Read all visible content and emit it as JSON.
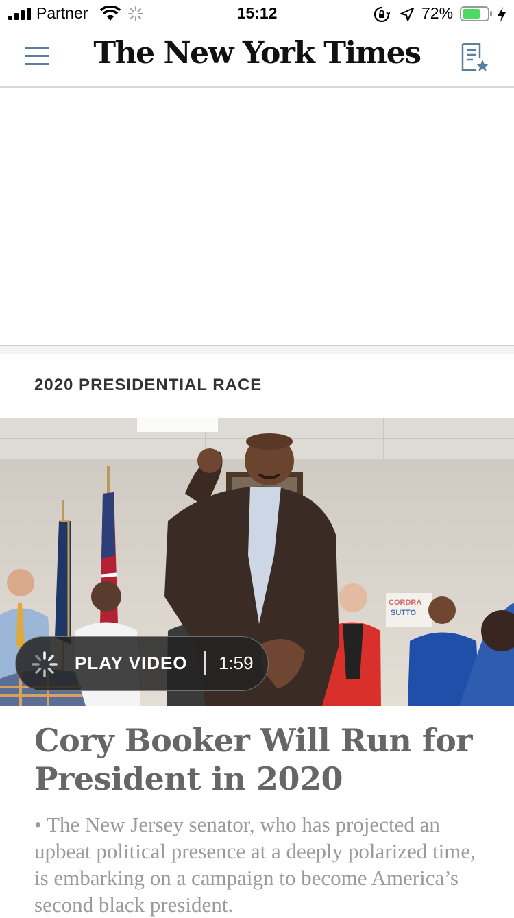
{
  "status_bar": {
    "carrier": "Partner",
    "time": "15:12",
    "battery_percent": "72%",
    "battery_level": 0.72,
    "icons": [
      "signal-icon",
      "wifi-icon",
      "activity-spinner-icon",
      "orientation-lock-icon",
      "location-icon",
      "battery-icon",
      "charging-bolt-icon"
    ]
  },
  "nav": {
    "logo": "The New York Times",
    "left_icon": "hamburger-menu-icon",
    "right_icon": "saved-articles-icon"
  },
  "article": {
    "kicker": "2020 PRESIDENTIAL RACE",
    "video": {
      "label": "PLAY VIDEO",
      "duration": "1:59"
    },
    "headline": "Cory Booker Will Run for President in 2020",
    "summary_bullet": "•",
    "summary": "The New Jersey senator, who has projected an upbeat political presence at a deeply polarized time, is embarking on a campaign to become America’s second black president."
  },
  "photo_sign_text": [
    "CORDRA",
    "SUTTO"
  ],
  "colors": {
    "accent": "#5a7f9c",
    "battery": "#4cd964"
  }
}
